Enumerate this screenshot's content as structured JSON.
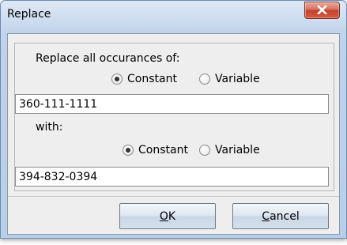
{
  "window": {
    "title": "Replace"
  },
  "find": {
    "label": "Replace all occurances of:",
    "value": "360-111-1111",
    "option_constant": "Constant",
    "option_variable": "Variable",
    "selected": "Constant"
  },
  "replace": {
    "label": "with:",
    "value": "394-832-0394",
    "option_constant": "Constant",
    "option_variable": "Variable",
    "selected": "Constant"
  },
  "buttons": {
    "ok_mnemonic": "O",
    "ok_rest": "K",
    "cancel_mnemonic": "C",
    "cancel_rest": "ancel"
  },
  "icons": {
    "close": "close-icon"
  }
}
